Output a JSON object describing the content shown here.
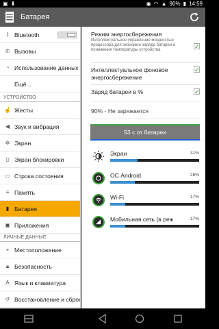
{
  "status_bar": {
    "battery": "90%",
    "time": "14:59"
  },
  "action_bar": {
    "title": "Батарея"
  },
  "sidebar": {
    "items_top": [
      {
        "label": "Bluetooth",
        "icon": "bluetooth-icon"
      },
      {
        "label": "Вызовы",
        "icon": "phone-icon"
      },
      {
        "label": "Использование данных",
        "icon": "data-usage-icon"
      },
      {
        "label": "Ещё...",
        "icon": ""
      }
    ],
    "section_device": "УСТРОЙСТВО",
    "items_device": [
      {
        "label": "Жесты",
        "icon": "gesture-icon"
      },
      {
        "label": "Звук и вибрация",
        "icon": "sound-icon"
      },
      {
        "label": "Экран",
        "icon": "display-icon"
      },
      {
        "label": "Экран блокировки",
        "icon": "lock-screen-icon"
      },
      {
        "label": "Строка состояния",
        "icon": "status-bar-icon"
      },
      {
        "label": "Память",
        "icon": "memory-icon"
      },
      {
        "label": "Батарея",
        "icon": "battery-icon"
      },
      {
        "label": "Приложения",
        "icon": "apps-icon"
      }
    ],
    "section_personal": "ЛИЧНЫЕ ДАННЫЕ",
    "items_personal": [
      {
        "label": "Местоположение",
        "icon": "location-icon"
      },
      {
        "label": "Безопасность",
        "icon": "security-icon"
      },
      {
        "label": "Язык и клавиатура",
        "icon": "language-icon"
      },
      {
        "label": "Восстановление и сброс",
        "icon": "reset-icon"
      }
    ]
  },
  "main": {
    "power_saving": {
      "title": "Режим энергосбережения",
      "subtitle": "Интеллектуальное управление мощностью процессора для экономии заряда батареи и понижения температуры устройства",
      "checked": true
    },
    "smart_background": {
      "title": "Интеллектуальное фоновое энергосбережение",
      "checked": true
    },
    "battery_percent": {
      "title": "Заряд батареи в %",
      "checked": true
    },
    "status": "90% - Не заряжается",
    "battery_time": "53 с от батареи",
    "usage": [
      {
        "label": "Экран",
        "percent": 31,
        "percent_text": "31%",
        "icon": "screen-brightness-icon"
      },
      {
        "label": "ОС Android",
        "percent": 28,
        "percent_text": "28%",
        "icon": "android-os-icon"
      },
      {
        "label": "Wi-Fi",
        "percent": 17,
        "percent_text": "17%",
        "icon": "wifi-icon"
      },
      {
        "label": "Мобильная сеть (в реж",
        "percent": 17,
        "percent_text": "17%",
        "icon": "mobile-network-icon"
      }
    ]
  },
  "colors": {
    "accent": "#f5a900",
    "check": "#2a8c20",
    "bar": "#3b8fd0"
  }
}
